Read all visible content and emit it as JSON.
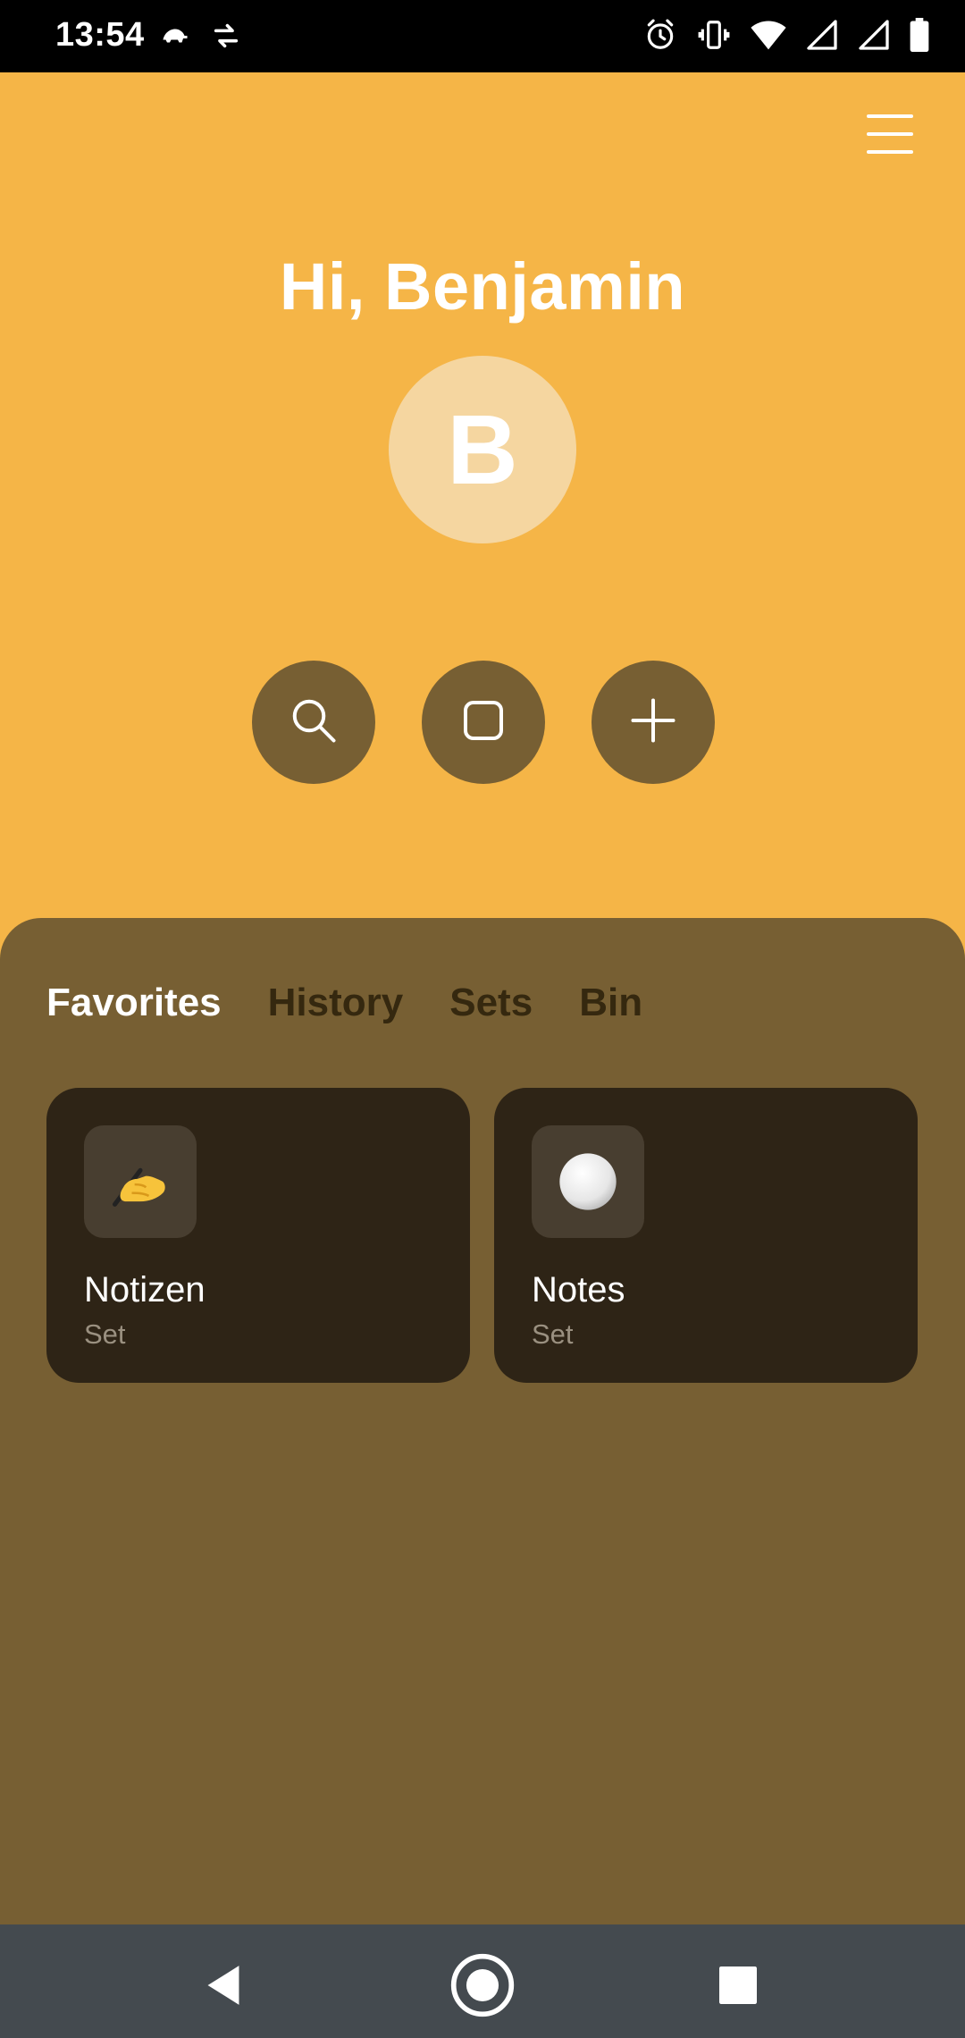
{
  "status_bar": {
    "time": "13:54",
    "left_icons": [
      "turtle-icon",
      "sync-arrows-icon"
    ],
    "right_icons": [
      "alarm-icon",
      "vibrate-icon",
      "wifi-icon",
      "signal-icon",
      "signal-icon",
      "battery-icon"
    ]
  },
  "header": {
    "greeting": "Hi, Benjamin",
    "avatar_initial": "B",
    "menu_icon": "hamburger-menu-icon"
  },
  "actions": [
    {
      "name": "search",
      "icon": "search-icon"
    },
    {
      "name": "square",
      "icon": "square-icon"
    },
    {
      "name": "add",
      "icon": "plus-icon"
    }
  ],
  "tabs": [
    {
      "label": "Favorites",
      "active": true
    },
    {
      "label": "History",
      "active": false
    },
    {
      "label": "Sets",
      "active": false
    },
    {
      "label": "Bin",
      "active": false
    }
  ],
  "cards": [
    {
      "emoji": "✍️",
      "title": "Notizen",
      "subtitle": "Set"
    },
    {
      "emoji": "⚪",
      "title": "Notes",
      "subtitle": "Set"
    }
  ],
  "nav": [
    "back-icon",
    "home-icon",
    "recents-icon"
  ],
  "colors": {
    "background": "#f5b547",
    "panel": "#775f33",
    "card": "#2e2416",
    "navbar": "#444a4f"
  }
}
